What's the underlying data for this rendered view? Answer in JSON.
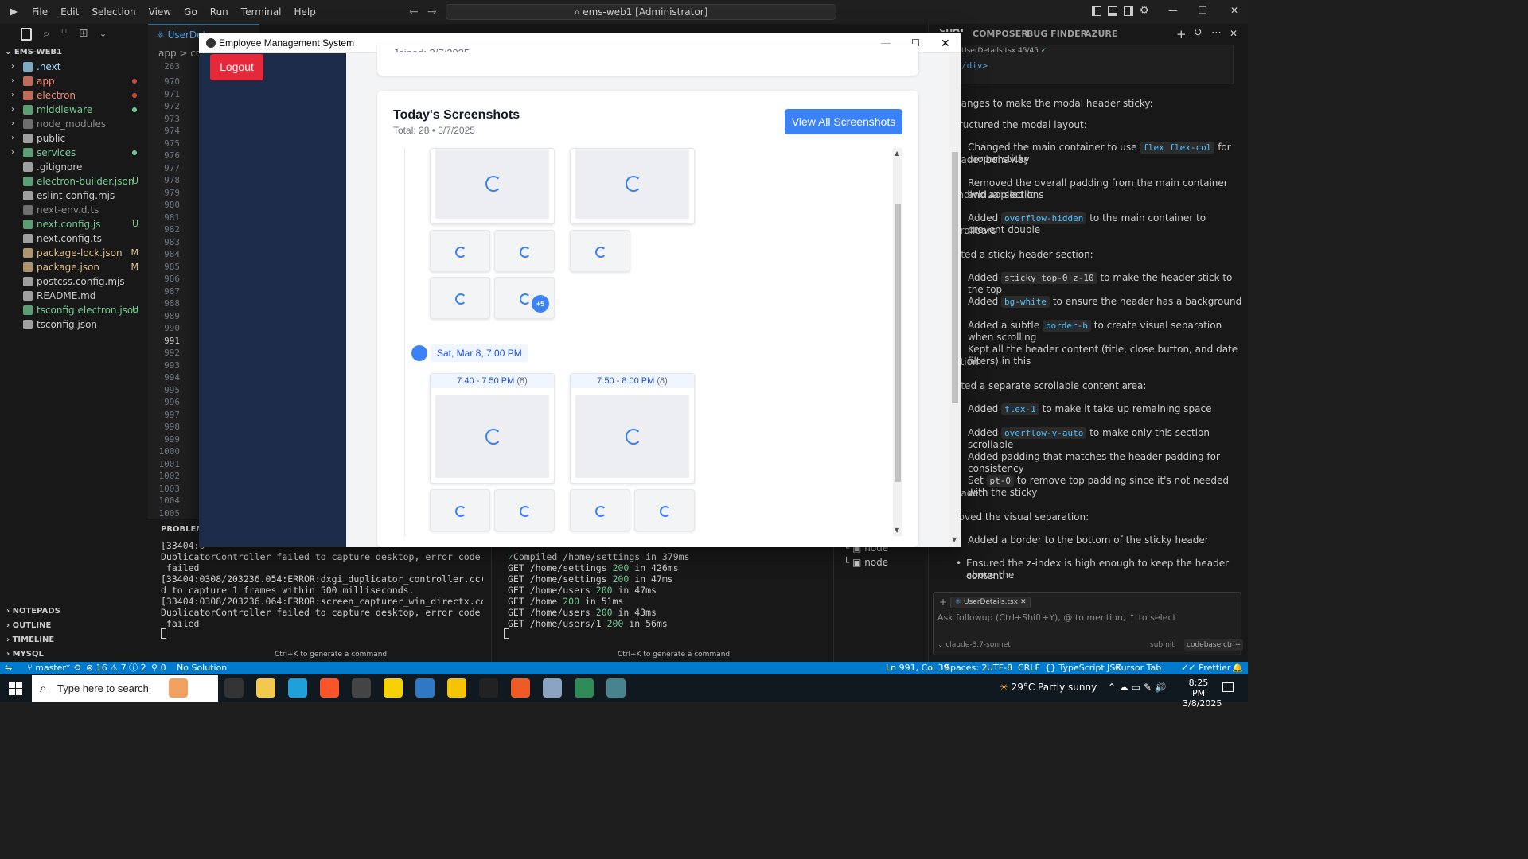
{
  "titlebar": {
    "menu": [
      "File",
      "Edit",
      "Selection",
      "View",
      "Go",
      "Run",
      "Terminal",
      "Help"
    ],
    "search": "ems-web1 [Administrator]"
  },
  "explorer": {
    "root": "EMS-WEB1",
    "items": [
      {
        "name": ".next",
        "folder": true,
        "color": "#9cdcfe",
        "status": ""
      },
      {
        "name": "app",
        "folder": true,
        "color": "#f48771",
        "status": "dot-red"
      },
      {
        "name": "electron",
        "folder": true,
        "color": "#f48771",
        "status": "dot-red"
      },
      {
        "name": "middleware",
        "folder": true,
        "color": "#73c991",
        "status": "dot-green"
      },
      {
        "name": "node_modules",
        "folder": true,
        "color": "#8c8c8c",
        "status": ""
      },
      {
        "name": "public",
        "folder": true,
        "color": "#cccccc",
        "status": ""
      },
      {
        "name": "services",
        "folder": true,
        "color": "#73c991",
        "status": "dot-green"
      },
      {
        "name": ".gitignore",
        "folder": false,
        "color": "#cccccc",
        "status": ""
      },
      {
        "name": "electron-builder.json",
        "folder": false,
        "color": "#73c991",
        "status": "U"
      },
      {
        "name": "eslint.config.mjs",
        "folder": false,
        "color": "#cccccc",
        "status": ""
      },
      {
        "name": "next-env.d.ts",
        "folder": false,
        "color": "#8c8c8c",
        "status": ""
      },
      {
        "name": "next.config.js",
        "folder": false,
        "color": "#73c991",
        "status": "U"
      },
      {
        "name": "next.config.ts",
        "folder": false,
        "color": "#cccccc",
        "status": ""
      },
      {
        "name": "package-lock.json",
        "folder": false,
        "color": "#e2c08d",
        "status": "M"
      },
      {
        "name": "package.json",
        "folder": false,
        "color": "#e2c08d",
        "status": "M"
      },
      {
        "name": "postcss.config.mjs",
        "folder": false,
        "color": "#cccccc",
        "status": ""
      },
      {
        "name": "README.md",
        "folder": false,
        "color": "#cccccc",
        "status": ""
      },
      {
        "name": "tsconfig.electron.json",
        "folder": false,
        "color": "#73c991",
        "status": "U"
      },
      {
        "name": "tsconfig.json",
        "folder": false,
        "color": "#cccccc",
        "status": ""
      }
    ],
    "sections": [
      "NOTEPADS",
      "OUTLINE",
      "TIMELINE",
      "MYSQL"
    ]
  },
  "editor": {
    "tab": "UserDet",
    "breadcrumb": "app > com",
    "lines": [
      "263",
      "970",
      "971",
      "972",
      "973",
      "974",
      "975",
      "976",
      "977",
      "978",
      "979",
      "980",
      "981",
      "982",
      "983",
      "984",
      "985",
      "986",
      "987",
      "988",
      "989",
      "990",
      "991",
      "992",
      "993",
      "994",
      "995",
      "996",
      "997",
      "998",
      "999",
      "1000",
      "1001",
      "1002",
      "1003",
      "1004",
      "1005"
    ],
    "current_line": "991"
  },
  "panel": {
    "tab": "PROBLEMS",
    "left_terminal": [
      "[33404:0",
      "DuplicatorController failed to capture desktop, error code Duplication",
      " failed",
      "[33404:0308/203236.054:ERROR:dxgi_duplicator_controller.cc(492)] Faile",
      "d to capture 1 frames within 500 milliseconds.",
      "[33404:0308/203236.064:ERROR:screen_capturer_win_directx.cc(150)] Dxgi",
      "DuplicatorController failed to capture desktop, error code Duplication",
      " failed"
    ],
    "right_terminal": [
      {
        "text": "Compiled /home/settings in 379ms",
        "check": true
      },
      {
        "pre": "GET /home/settings ",
        "code": "200",
        "post": " in 426ms"
      },
      {
        "pre": "GET /home/settings ",
        "code": "200",
        "post": " in 47ms"
      },
      {
        "pre": "GET /home/users ",
        "code": "200",
        "post": " in 47ms"
      },
      {
        "pre": "GET /home ",
        "code": "200",
        "post": " in 51ms"
      },
      {
        "pre": "GET /home/users ",
        "code": "200",
        "post": " in 43ms"
      },
      {
        "pre": "GET /home/users/1 ",
        "code": "200",
        "post": " in 56ms"
      }
    ],
    "hint_left": "Ctrl+K to generate a command",
    "hint_right": "Ctrl+K to generate a command",
    "tree": [
      "node",
      "node"
    ]
  },
  "chat": {
    "tabs": [
      "CHAT",
      "COMPOSER",
      "BUG FINDER",
      "AZURE"
    ],
    "file_ref": "UserDetails.tsx 45/45",
    "closing_tag": "div>",
    "lines": [
      {
        "text": "hanges to make the modal header sticky:"
      },
      {
        "text": "tructured the modal layout:"
      },
      {
        "text": "Changed the main container to use ",
        "code": "flex flex-col",
        "after": " for proper sticky"
      },
      {
        "text": "eader behavior"
      },
      {
        "text": "Removed the overall padding from the main container and applied it"
      },
      {
        "text": " individual sections"
      },
      {
        "text": "Added ",
        "code": "overflow-hidden",
        "after": " to the main container to prevent double"
      },
      {
        "text": "crollbars"
      },
      {
        "text": "ated a sticky header section:"
      },
      {
        "text": "Added ",
        "code": "sticky top-0 z-10",
        "after": " to make the header stick to the top"
      },
      {
        "text": "Added ",
        "code": "bg-white",
        "after": " to ensure the header has a background"
      },
      {
        "text": "Added a subtle ",
        "code": "border-b",
        "after": " to create visual separation when scrolling"
      },
      {
        "text": "Kept all the header content (title, close button, and date filters) in this"
      },
      {
        "text": "ction"
      },
      {
        "text": "ated a separate scrollable content area:"
      },
      {
        "text": "Added ",
        "code": "flex-1",
        "after": " to make it take up remaining space"
      },
      {
        "text": "Added ",
        "code": "overflow-y-auto",
        "after": " to make only this section scrollable"
      },
      {
        "text": "Added padding that matches the header padding for consistency"
      },
      {
        "text": "Set ",
        "code": "pt-0",
        "after": " to remove top padding since it's not needed with the sticky"
      },
      {
        "text": "eader"
      },
      {
        "text": "roved the visual separation:"
      },
      {
        "text": "Added a border to the bottom of the sticky header"
      },
      {
        "text": "Ensured the z-index is high enough to keep the header above the"
      },
      {
        "text": "content"
      }
    ],
    "chip": "UserDetails.tsx",
    "input_placeholder": "Ask followup (Ctrl+Shift+Y), @ to mention, ↑ to select",
    "model": "claude-3.7-sonnet",
    "submit": "submit",
    "codebase": "codebase ctrl+"
  },
  "status": {
    "branch": "master*",
    "errors": "16",
    "warnings": "7",
    "info": "2",
    "ports": "0",
    "solution": "No Solution",
    "position": "Ln 991, Col 39",
    "spaces": "Spaces: 2",
    "encoding": "UTF-8",
    "eol": "CRLF",
    "language": "TypeScript JSX",
    "tab": "Cursor Tab",
    "prettier": "Prettier"
  },
  "taskbar": {
    "search": "Type here to search",
    "weather": "29°C  Partly sunny",
    "time": "8:25 PM",
    "date": "3/8/2025"
  },
  "app": {
    "title": "Employee Management System",
    "logout": "Logout",
    "joined_partial": "Joined: 3/7/2025",
    "screenshots_title": "Today's Screenshots",
    "screenshots_sub": "Total: 28 • 3/7/2025",
    "view_all": "View All Screenshots",
    "more_badge": "+5",
    "session_label": "Sat, Mar 8, 7:00 PM",
    "groups": [
      {
        "time": "7:40 - 7:50 PM",
        "count": "(8)"
      },
      {
        "time": "7:50 - 8:00 PM",
        "count": "(8)"
      }
    ]
  },
  "colors": {
    "accent": "#3b82f6",
    "logout": "#e5283a",
    "app_sidebar": "#1b2b48",
    "status_bar": "#007acc"
  }
}
